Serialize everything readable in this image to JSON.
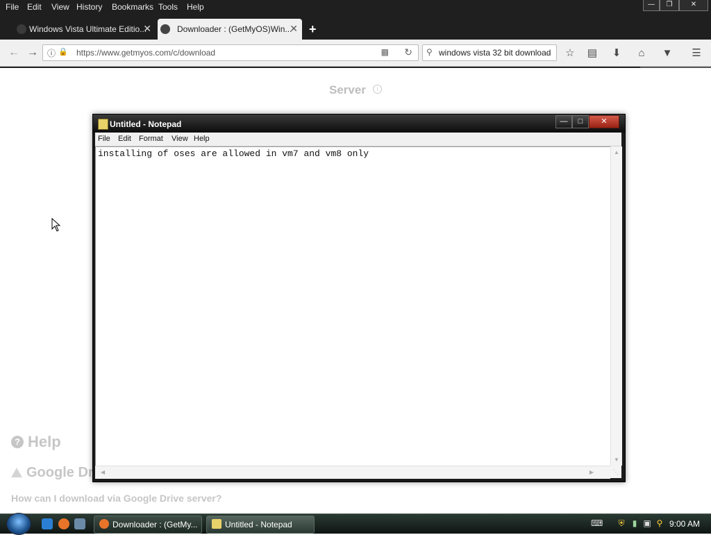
{
  "browser": {
    "menu": [
      "File",
      "Edit",
      "View",
      "History",
      "Bookmarks",
      "Tools",
      "Help"
    ],
    "tabs": [
      {
        "title": "Windows Vista Ultimate Editio...",
        "active": false
      },
      {
        "title": "Downloader : (GetMyOS)Win...",
        "active": true
      }
    ],
    "url": "https://www.getmyos.com/c/download",
    "search_query": "windows vista 32 bit download"
  },
  "page": {
    "server_heading": "Server",
    "help_heading": "Help",
    "google_drive_heading": "Google Drive",
    "google_drive_question": "How can I download via Google Drive server?"
  },
  "notepad": {
    "title": "Untitled - Notepad",
    "menu": [
      "File",
      "Edit",
      "Format",
      "View",
      "Help"
    ],
    "text": "installing of oses are allowed in vm7 and vm8 only"
  },
  "taskbar": {
    "buttons": [
      {
        "label": "Downloader : (GetMy..."
      },
      {
        "label": "Untitled - Notepad"
      }
    ],
    "clock": "9:00 AM"
  }
}
